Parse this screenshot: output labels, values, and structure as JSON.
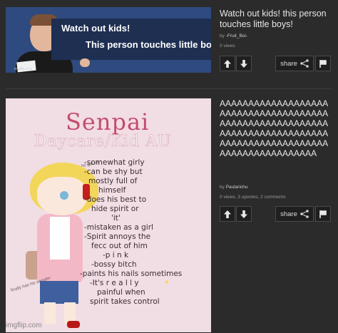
{
  "posts": [
    {
      "title": "Watch out kids! this person touches little boys!",
      "author_prefix": "by",
      "author": "-Fruit_Boi-",
      "stats": "0 views",
      "share_label": "share",
      "thumbnail": {
        "line1": "Watch out kids!",
        "line2": "This person touches little boys!",
        "watermark": "imgflip.com"
      }
    },
    {
      "title": "AAAAAAAAAAAAAAAAAAAAAAAAAAAAAAAAAAAAAAAAAAAAAAAAAAAAAAAAAAAAAAAAAAAAAAAAAAAAAAAAAAAAAAAAAAAAAAAAAAAAAAAAAAAAAAAA",
      "author_prefix": "by",
      "author": "Paularichu",
      "stats": "0 views, 3 upvotes, 2 comments",
      "share_label": "share",
      "thumbnail": {
        "title": "Senpai",
        "subtitle": "Daycare/Kid AU",
        "notes": [
          "-somewhat girly",
          "-can be shy but",
          "mostly full of",
          "himself",
          "-does his best to",
          "hide spirit or",
          "'it'",
          "-mistaken as a girl",
          "-Spirit annoys the",
          "fecc out of him",
          "-p i n k",
          "-bossy bitch",
          "-paints his nails sometimes",
          "-It's r e a l l y",
          "painful when",
          "spirit takes control"
        ],
        "side_note_1": "he got hit",
        "side_note_2": "finally has his sweater",
        "watermark": "imgflip.com"
      }
    }
  ],
  "colors": {
    "page_bg": "#2b2b2b",
    "button_bg": "#1f1f1f",
    "text": "#e6e6e6",
    "meta": "#9a9a9a"
  },
  "icons": [
    "upvote-arrow-icon",
    "downvote-arrow-icon",
    "share-icon",
    "flag-icon"
  ]
}
